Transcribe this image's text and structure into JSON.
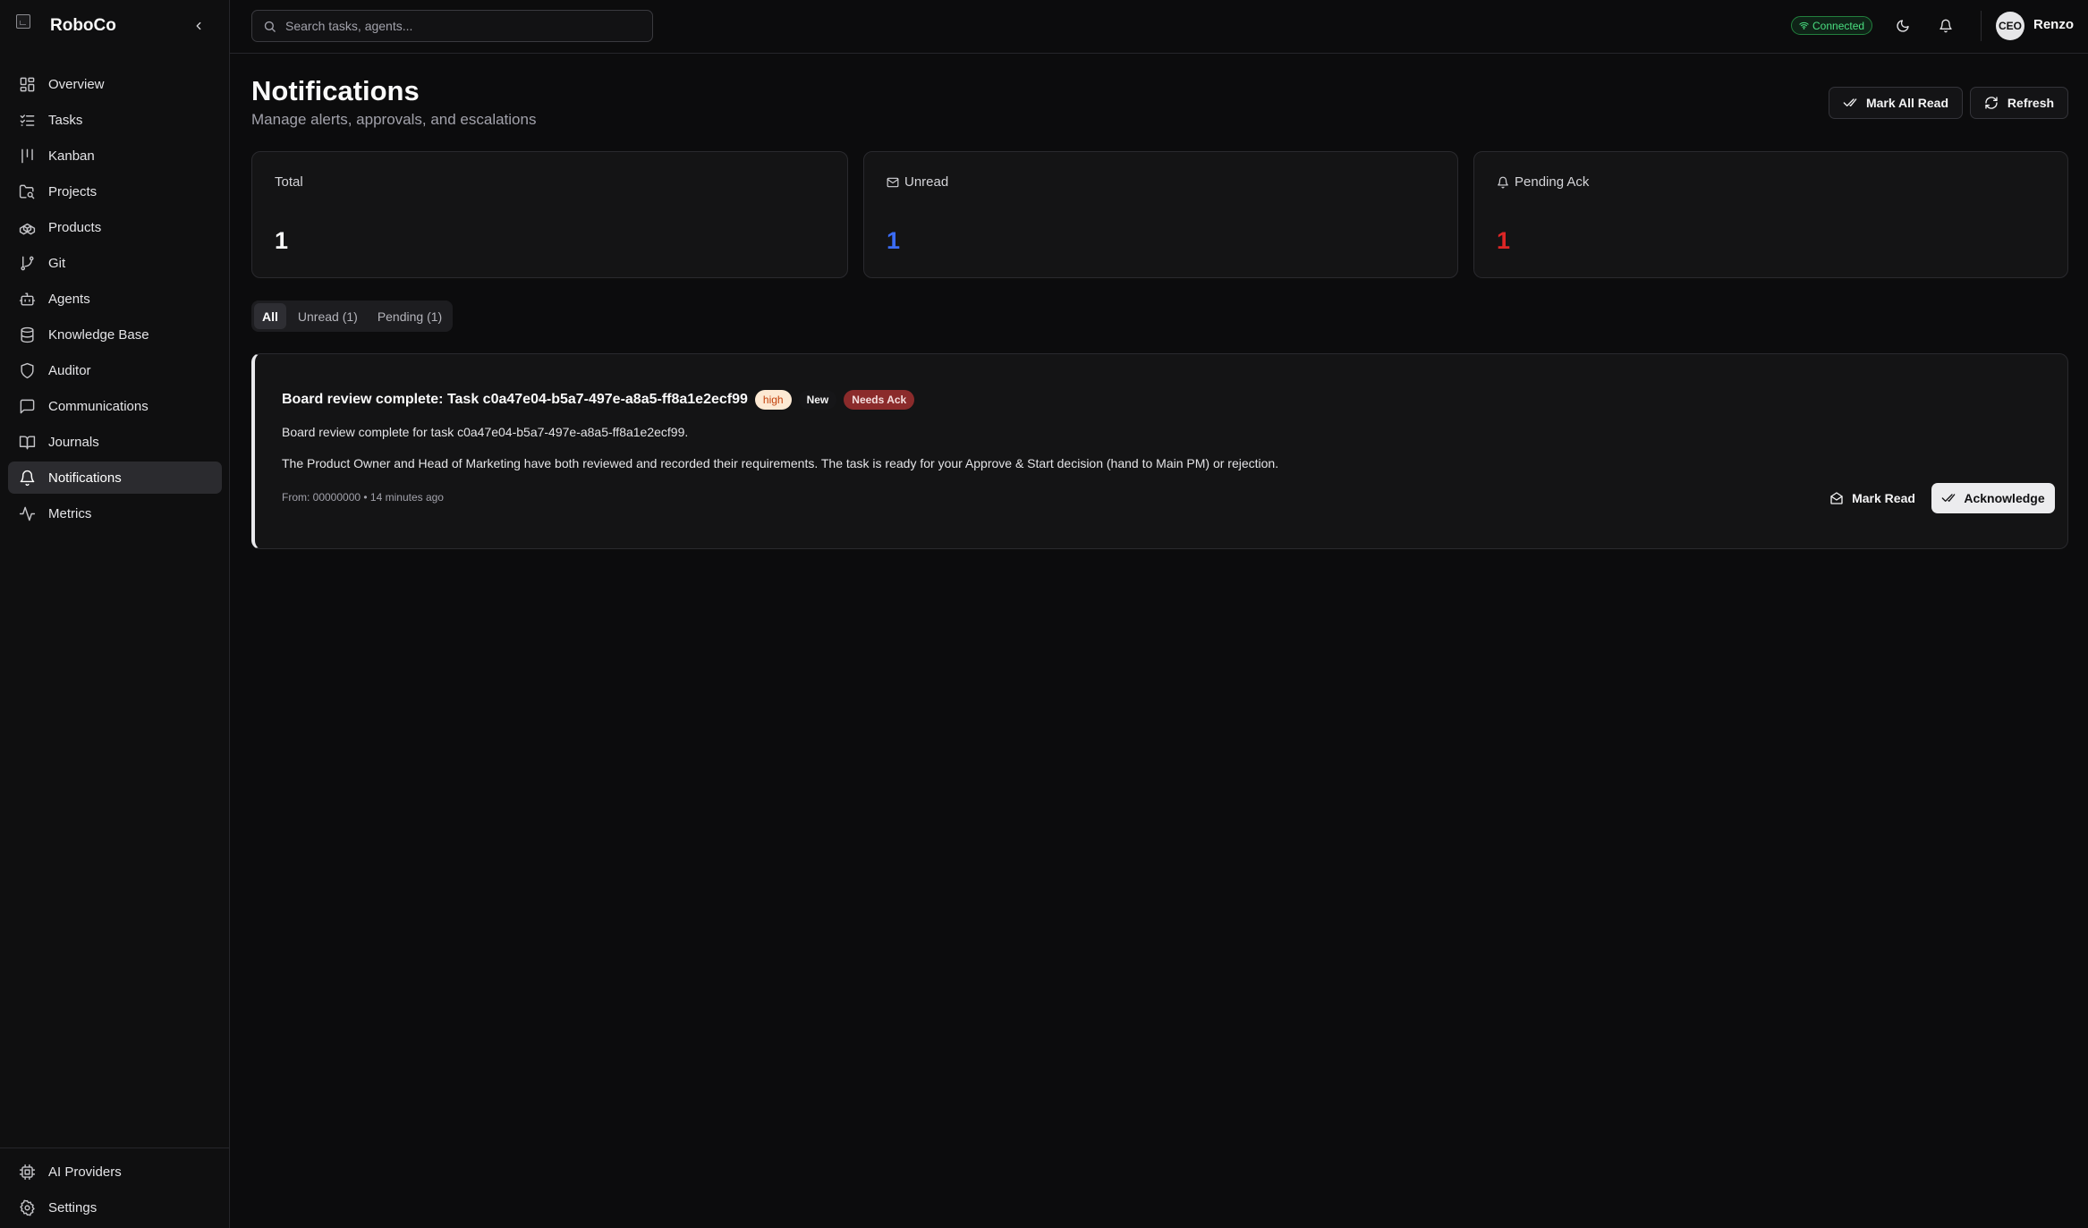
{
  "app": {
    "name": "RoboCo"
  },
  "sidebar": {
    "items": [
      {
        "label": "Overview",
        "icon": "grid-icon"
      },
      {
        "label": "Tasks",
        "icon": "list-checks-icon"
      },
      {
        "label": "Kanban",
        "icon": "kanban-icon"
      },
      {
        "label": "Projects",
        "icon": "folder-search-icon"
      },
      {
        "label": "Products",
        "icon": "boxes-icon"
      },
      {
        "label": "Git",
        "icon": "git-branch-icon"
      },
      {
        "label": "Agents",
        "icon": "bot-icon"
      },
      {
        "label": "Knowledge Base",
        "icon": "database-icon"
      },
      {
        "label": "Auditor",
        "icon": "shield-icon"
      },
      {
        "label": "Communications",
        "icon": "message-square-icon"
      },
      {
        "label": "Journals",
        "icon": "book-open-icon"
      },
      {
        "label": "Notifications",
        "icon": "bell-icon",
        "active": true
      },
      {
        "label": "Metrics",
        "icon": "activity-icon"
      }
    ],
    "bottom": [
      {
        "label": "AI Providers",
        "icon": "cpu-icon"
      },
      {
        "label": "Settings",
        "icon": "gear-icon"
      }
    ]
  },
  "header": {
    "search_placeholder": "Search tasks, agents...",
    "connection_status": "Connected",
    "avatar_initials": "CEO",
    "user_name": "Renzo"
  },
  "page": {
    "title": "Notifications",
    "subtitle": "Manage alerts, approvals, and escalations",
    "mark_all_read": "Mark All Read",
    "refresh": "Refresh"
  },
  "stats": {
    "total": {
      "label": "Total",
      "value": "1"
    },
    "unread": {
      "label": "Unread",
      "value": "1",
      "color": "#3b6cf6"
    },
    "pending": {
      "label": "Pending Ack",
      "value": "1",
      "color": "#dc2626"
    }
  },
  "tabs": [
    "All",
    "Unread (1)",
    "Pending (1)"
  ],
  "notification": {
    "title": "Board review complete: Task c0a47e04-b5a7-497e-a8a5-ff8a1e2ecf99",
    "priority": "high",
    "status_new": "New",
    "status_ack": "Needs Ack",
    "body_line1": "Board review complete for task c0a47e04-b5a7-497e-a8a5-ff8a1e2ecf99.",
    "body_line2": "The Product Owner and Head of Marketing have both reviewed and recorded their requirements. The task is ready for your Approve & Start decision (hand to Main PM) or rejection.",
    "meta": "From: 00000000 • 14 minutes ago",
    "mark_read": "Mark Read",
    "acknowledge": "Acknowledge"
  }
}
